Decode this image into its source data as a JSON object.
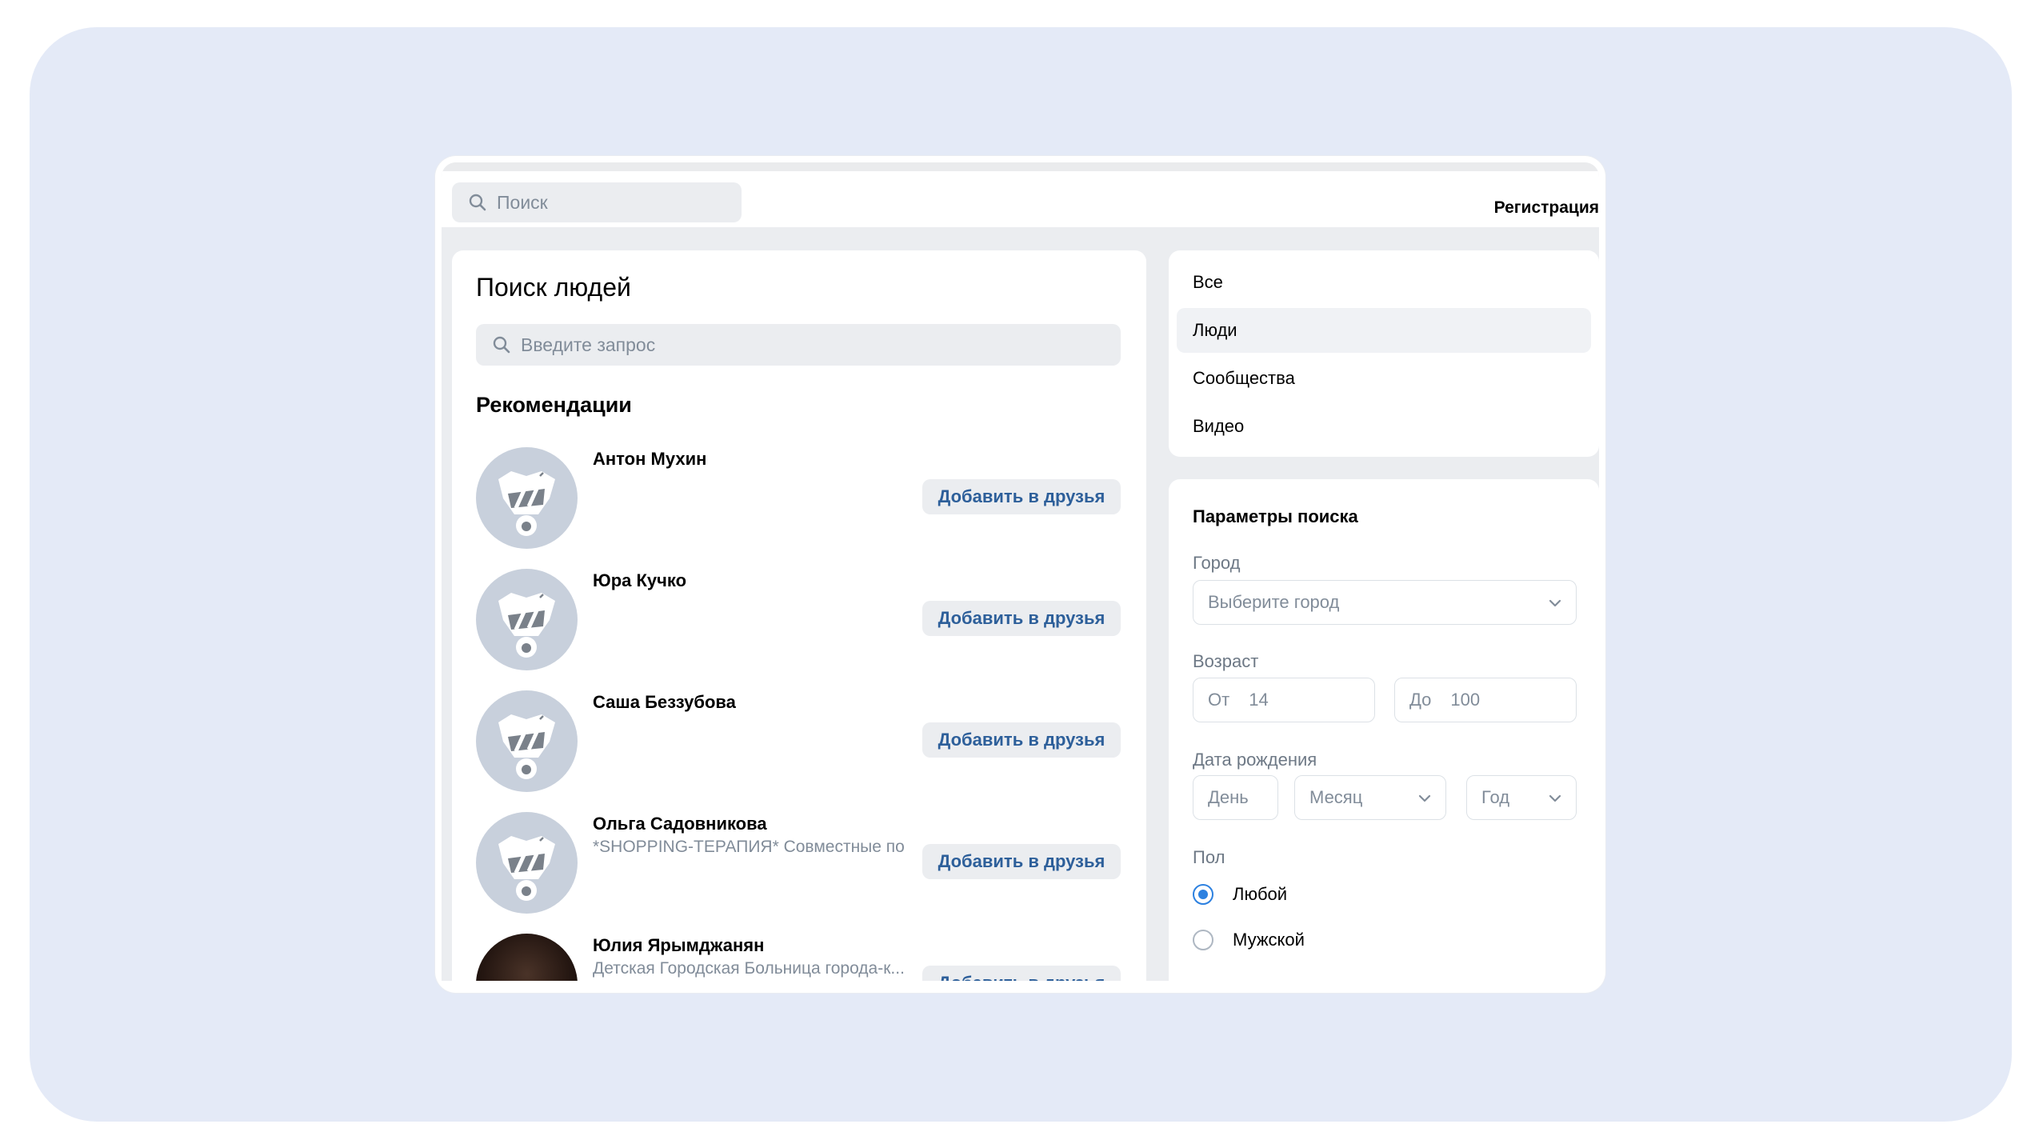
{
  "header": {
    "search_placeholder": "Поиск",
    "register_label": "Регистрация"
  },
  "main": {
    "title": "Поиск людей",
    "query_placeholder": "Введите запрос",
    "recommendations_title": "Рекомендации",
    "add_friend_label": "Добавить в друзья",
    "people": [
      {
        "name": "Антон Мухин",
        "desc": ""
      },
      {
        "name": "Юра Кучко",
        "desc": ""
      },
      {
        "name": "Саша Беззубова",
        "desc": ""
      },
      {
        "name": "Ольга Садовникова",
        "desc": "*SHOPPING-ТЕРАПИЯ* Совместные по..."
      },
      {
        "name": "Юлия Ярымджанян",
        "desc": "Детская Городская Больница города-к..."
      }
    ]
  },
  "nav": {
    "items": [
      {
        "label": "Все",
        "active": false
      },
      {
        "label": "Люди",
        "active": true
      },
      {
        "label": "Сообщества",
        "active": false
      },
      {
        "label": "Видео",
        "active": false
      }
    ]
  },
  "params": {
    "title": "Параметры поиска",
    "city_label": "Город",
    "city_placeholder": "Выберите город",
    "age_label": "Возраст",
    "age_from_prefix": "От",
    "age_from_value": "14",
    "age_to_prefix": "До",
    "age_to_value": "100",
    "birth_label": "Дата рождения",
    "day_placeholder": "День",
    "month_placeholder": "Месяц",
    "year_placeholder": "Год",
    "gender_label": "Пол",
    "gender_options": [
      {
        "label": "Любой",
        "selected": true
      },
      {
        "label": "Мужской",
        "selected": false
      }
    ]
  },
  "colors": {
    "accent": "#2d81e0",
    "button_text": "#2d5f9a",
    "backdrop": "#e4eaf7"
  }
}
